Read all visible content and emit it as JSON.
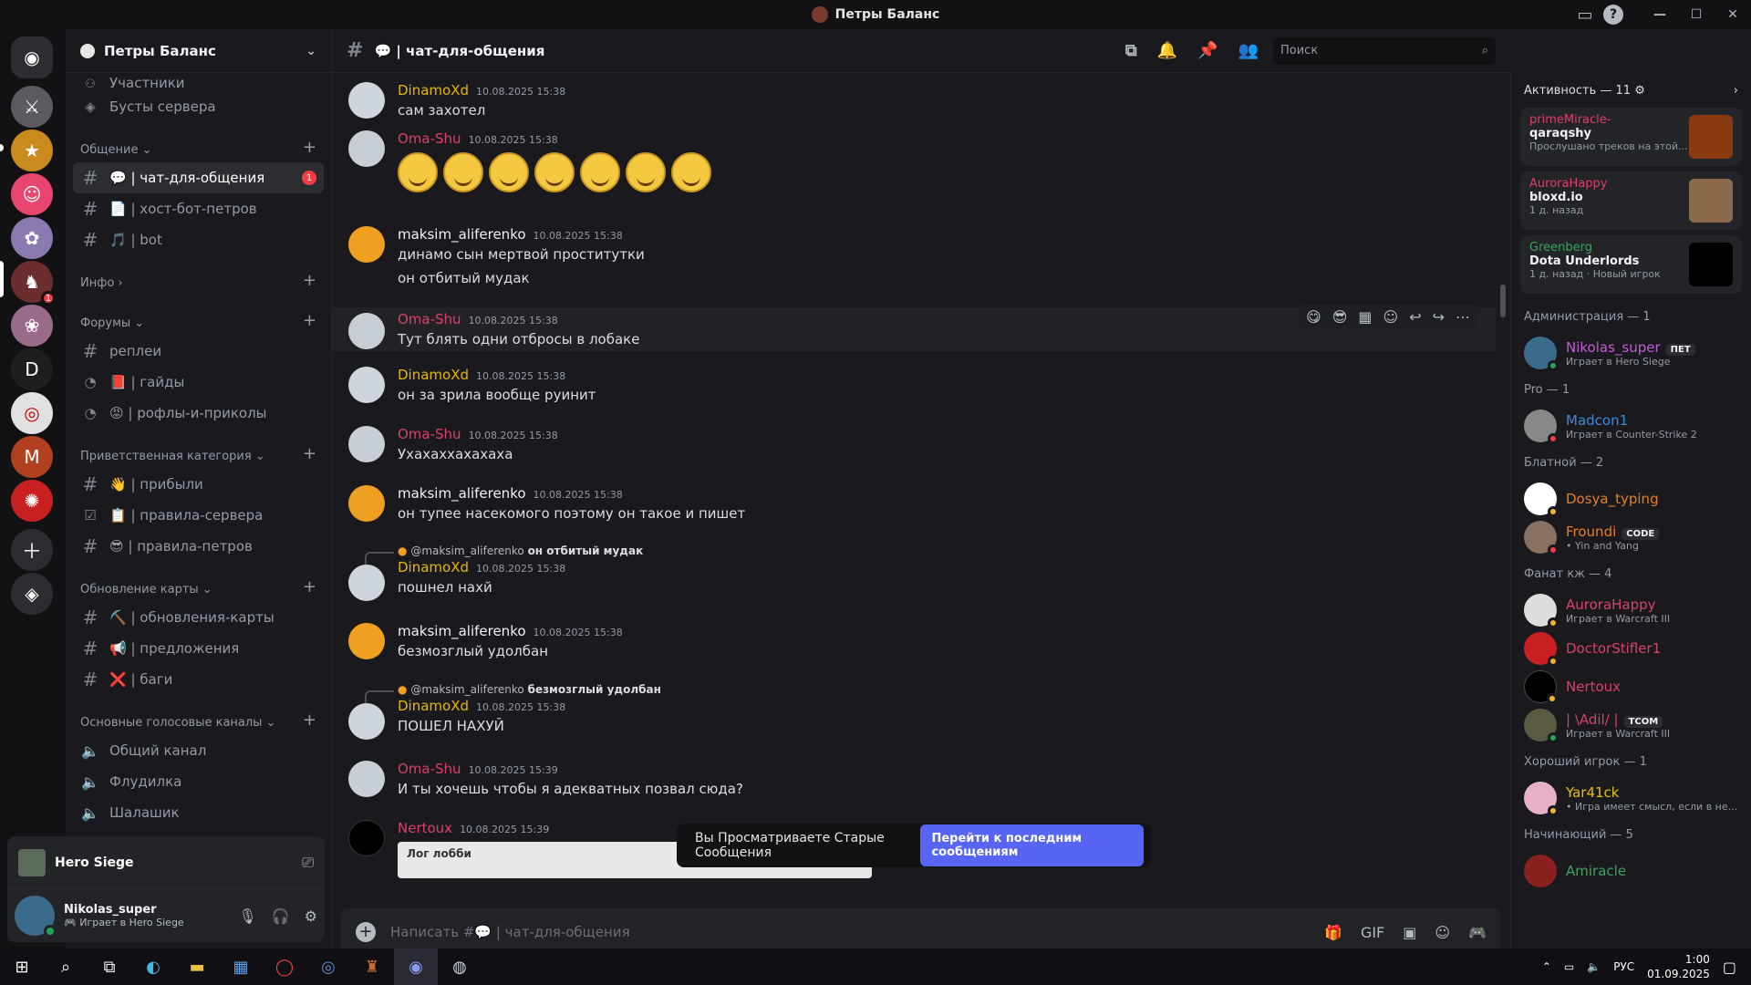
{
  "window": {
    "title": "Петры Баланс"
  },
  "server": {
    "name": "Петры Баланс"
  },
  "channel_sidebar": {
    "cut_top": "Участники",
    "boosts": "Бусты сервера",
    "categories": [
      {
        "name": "Общение",
        "channels": [
          "💬 | чат-для-общения",
          "📄 | хост-бот-петров",
          "🎵 | bot"
        ]
      },
      {
        "name": "Инфо",
        "channels": []
      },
      {
        "name": "Форумы",
        "channels": [
          "реплеи",
          "📕 | гайды",
          "😡 | рофлы-и-приколы"
        ]
      },
      {
        "name": "Приветственная категория",
        "channels": [
          "👋 | прибыли",
          "📋 | правила-сервера",
          "😎 | правила-петров"
        ]
      },
      {
        "name": "Обновление карты",
        "channels": [
          "⛏️ | обновления-карты",
          "📢 | предложения",
          "❌ | баги"
        ]
      },
      {
        "name": "Основные голосовые каналы",
        "channels": [
          "Общий канал",
          "Флудилка",
          "Шалашик"
        ]
      }
    ],
    "active_unread": "1"
  },
  "voice_panel": {
    "game": "Hero Siege",
    "user": "Nikolas_super",
    "status": "Играет в Hero Siege"
  },
  "channel_header": {
    "name": "💬 | чат-для-общения",
    "search_placeholder": "Поиск"
  },
  "messages": [
    {
      "author": "DinamoXd",
      "ts": "10.08.2025 15:38",
      "text": "сам захотел"
    },
    {
      "author": "Oma-Shu",
      "ts": "10.08.2025 15:38",
      "text": ""
    },
    {
      "author": "maksim_aliferenko",
      "ts": "10.08.2025 15:38",
      "text": "динамо сын мертвой проститутки",
      "text2": "он отбитый мудак"
    },
    {
      "author": "Oma-Shu",
      "ts": "10.08.2025 15:38",
      "text": "Тут блять одни отбросы в лобаке"
    },
    {
      "author": "DinamoXd",
      "ts": "10.08.2025 15:38",
      "text": "он за зрила вообще руинит"
    },
    {
      "author": "Oma-Shu",
      "ts": "10.08.2025 15:38",
      "text": "Ухахаххахахаха"
    },
    {
      "author": "maksim_aliferenko",
      "ts": "10.08.2025 15:38",
      "text": "он тупее насекомого поэтому он такое и пишет"
    },
    {
      "author": "DinamoXd",
      "ts": "10.08.2025 15:38",
      "text": "пошнел нахй",
      "reply_to": "@maksim_aliferenko",
      "reply_text": "он отбитый мудак"
    },
    {
      "author": "maksim_aliferenko",
      "ts": "10.08.2025 15:38",
      "text": "безмозглый удолбан"
    },
    {
      "author": "DinamoXd",
      "ts": "10.08.2025 15:38",
      "text": "ПОШЕЛ НАХУЙ",
      "reply_to": "@maksim_aliferenko",
      "reply_text": "безмозглый удолбан"
    },
    {
      "author": "Oma-Shu",
      "ts": "10.08.2025 15:39",
      "text": "И ты хочешь чтобы я адекватных позвал сюда?"
    },
    {
      "author": "Nertoux",
      "ts": "10.08.2025 15:39",
      "text": "",
      "embed": "Лог лобби"
    }
  ],
  "toast": {
    "text": "Вы Просматриваете Старые Сообщения",
    "button": "Перейти к последним сообщениям"
  },
  "composer": {
    "placeholder": "Написать #💬 | чат-для-общения"
  },
  "members": {
    "activity_header": "Активность — 11",
    "activities": [
      {
        "user": "primeMiracle-",
        "title": "qaraqshy",
        "sub": "Прослушано треков на этой..."
      },
      {
        "user": "AuroraHappy",
        "title": "bloxd.io",
        "sub": "1 д. назад"
      },
      {
        "user": "Greenberg",
        "title": "Dota Underlords",
        "sub": "1 д. назад · Новый игрок"
      }
    ],
    "groups": [
      {
        "title": "Администрация — 1",
        "members": [
          {
            "name": "Nikolas_super",
            "tag": "ПЕТ",
            "act": "Играет в Hero Siege"
          }
        ]
      },
      {
        "title": "Pro — 1",
        "members": [
          {
            "name": "Madcon1",
            "tag": "",
            "act": "Играет в Counter-Strike 2"
          }
        ]
      },
      {
        "title": "Блатной — 2",
        "members": [
          {
            "name": "Dosya_typing",
            "tag": "",
            "act": ""
          },
          {
            "name": "Froundi",
            "tag": "CODE",
            "act": "• Yin and Yang"
          }
        ]
      },
      {
        "title": "Фанат кж — 4",
        "members": [
          {
            "name": "AuroraHappy",
            "tag": "",
            "act": "Играет в Warcraft III"
          },
          {
            "name": "DoctorStifler1",
            "tag": "",
            "act": ""
          },
          {
            "name": "Nertoux",
            "tag": "",
            "act": ""
          },
          {
            "name": "| \\Adil/ |",
            "tag": "TCOM",
            "act": "Играет в Warcraft III"
          }
        ]
      },
      {
        "title": "Хороший игрок — 1",
        "members": [
          {
            "name": "Yar41ck",
            "tag": "",
            "act": "• Игра имеет смысл, если в не..."
          }
        ]
      },
      {
        "title": "Начинающий — 5",
        "members": [
          {
            "name": "Amiracle",
            "tag": "",
            "act": ""
          }
        ]
      }
    ]
  },
  "taskbar": {
    "lang": "РУС",
    "time": "1:00",
    "date": "01.09.2025"
  },
  "colors": {
    "dinamo": "#e6b800",
    "oma": "#d9406a",
    "maksim": "#f2f3f5",
    "nertoux": "#d9406a",
    "accent": "#5865f2"
  }
}
